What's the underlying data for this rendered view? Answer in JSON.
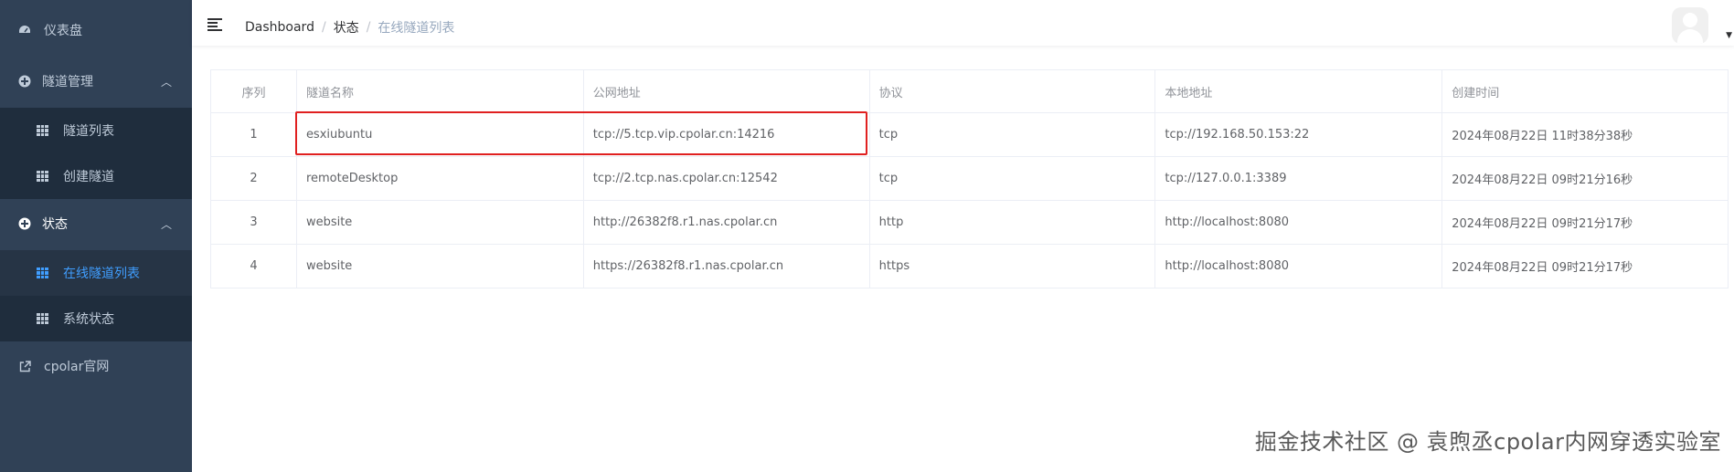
{
  "sidebar": {
    "dashboard": "仪表盘",
    "tunnel_mgmt": "隧道管理",
    "tunnel_list": "隧道列表",
    "create_tunnel": "创建隧道",
    "status": "状态",
    "online_tunnel_list": "在线隧道列表",
    "system_status": "系统状态",
    "official_site": "cpolar官网"
  },
  "breadcrumb": [
    "Dashboard",
    "状态",
    "在线隧道列表"
  ],
  "table": {
    "headers": [
      "序列",
      "隧道名称",
      "公网地址",
      "协议",
      "本地地址",
      "创建时间"
    ],
    "rows": [
      [
        "1",
        "esxiubuntu",
        "tcp://5.tcp.vip.cpolar.cn:14216",
        "tcp",
        "tcp://192.168.50.153:22",
        "2024年08月22日 11时38分38秒"
      ],
      [
        "2",
        "remoteDesktop",
        "tcp://2.tcp.nas.cpolar.cn:12542",
        "tcp",
        "tcp://127.0.0.1:3389",
        "2024年08月22日 09时21分16秒"
      ],
      [
        "3",
        "website",
        "http://26382f8.r1.nas.cpolar.cn",
        "http",
        "http://localhost:8080",
        "2024年08月22日 09时21分17秒"
      ],
      [
        "4",
        "website",
        "https://26382f8.r1.nas.cpolar.cn",
        "https",
        "http://localhost:8080",
        "2024年08月22日 09时21分17秒"
      ]
    ]
  },
  "watermark": "掘金技术社区 @ 袁煦丞cpolar内网穿透实验室",
  "colors": {
    "sidebar_bg": "#304156",
    "submenu_bg": "#1f2d3d",
    "active": "#409eff",
    "highlight": "#e02020"
  }
}
